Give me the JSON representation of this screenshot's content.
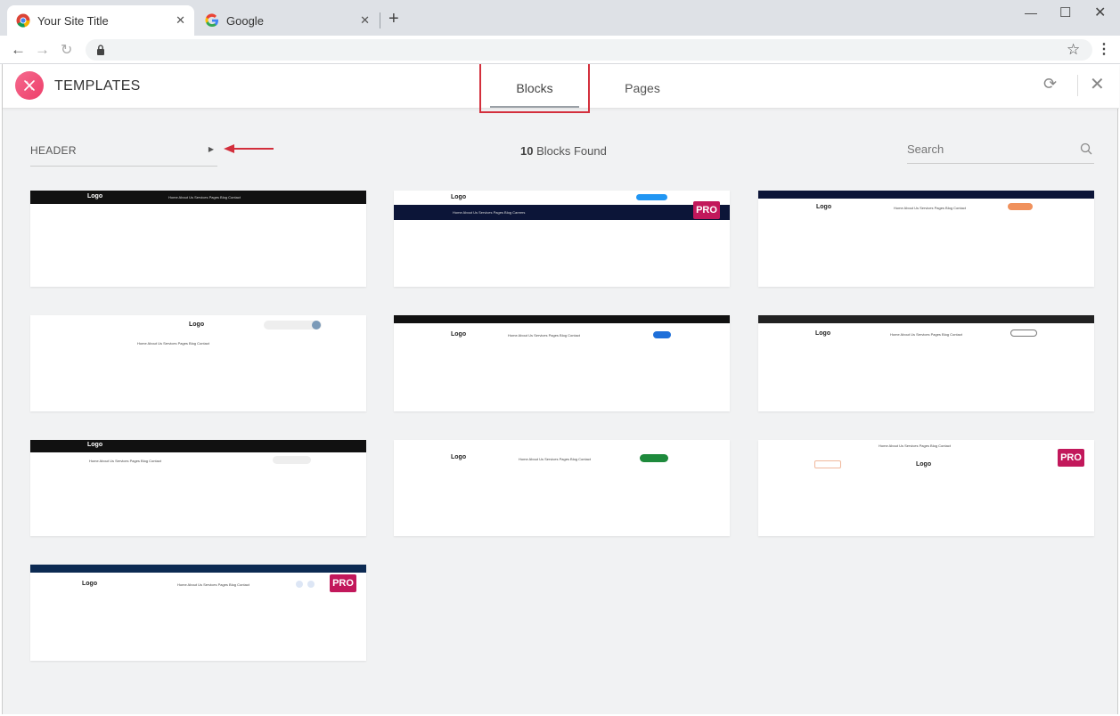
{
  "browser": {
    "tabs": [
      {
        "title": "Your Site Title",
        "active": true
      },
      {
        "title": "Google",
        "active": false
      }
    ]
  },
  "modal": {
    "brand": "TEMPLATES",
    "tabs": [
      {
        "label": "Blocks",
        "selected": true
      },
      {
        "label": "Pages",
        "selected": false
      }
    ],
    "filter": {
      "label": "HEADER"
    },
    "found_count": "10",
    "found_suffix": "Blocks Found",
    "search_placeholder": "Search",
    "accent_color": "#d32f3c",
    "pro_color": "#c2185b"
  },
  "blocks": [
    {
      "logo": "Logo",
      "pro": false,
      "menu": "Home   About Us   Services   Pages   Blog   Contact"
    },
    {
      "logo": "Logo",
      "pro": true,
      "menu": "Home   About Us   Services   Pages   Blog   Careers"
    },
    {
      "logo": "Logo",
      "pro": false,
      "menu": "Home   About Us   Services   Pages   Blog   Contact"
    },
    {
      "logo": "Logo",
      "pro": false,
      "menu": "Home   About Us   Services   Pages   Blog   Contact"
    },
    {
      "logo": "Logo",
      "pro": false,
      "menu": "Home   About Us   Services   Pages   Blog   Contact"
    },
    {
      "logo": "Logo",
      "pro": false,
      "menu": "Home   About Us   Services   Pages   Blog   Contact"
    },
    {
      "logo": "Logo",
      "pro": false,
      "menu": "Home   About Us   Services   Pages   Blog   Contact"
    },
    {
      "logo": "Logo",
      "pro": false,
      "menu": "Home   About Us   Services   Pages   Blog   Contact"
    },
    {
      "logo": "Logo",
      "pro": true,
      "menu": "Home   About Us   Services   Pages   Blog   Contact"
    },
    {
      "logo": "Logo",
      "pro": true,
      "menu": "Home   About Us   Services   Pages   Blog   Contact"
    }
  ],
  "pro_label": "PRO"
}
